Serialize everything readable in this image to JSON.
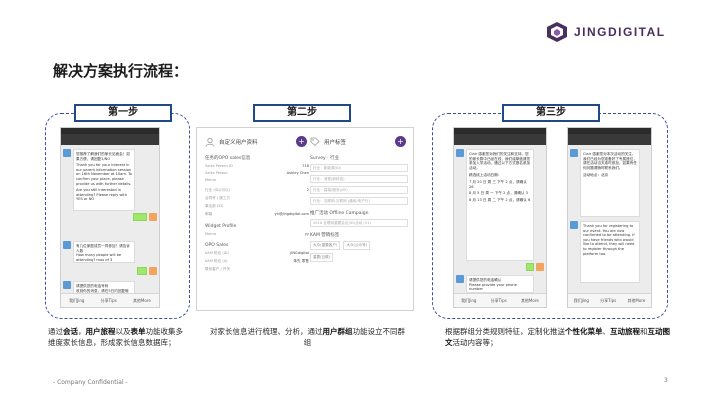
{
  "logo": {
    "text": "JINGDIGITAL"
  },
  "title": "解决方案执行流程：",
  "steps": [
    "第一步",
    "第二步",
    "第三步"
  ],
  "phone1": {
    "bottom": [
      "我们Jing",
      "分享Tips",
      "其他More"
    ],
    "msg1": "您推荐了解我们的家长见面会！如果方便，请回复1/NO",
    "msg2": "Thank you for your interest in our parent information session on 16th November at 10am. To confirm your place, please provide us with further details.",
    "msg3": "Are you still interested in attending? Please reply with YES or NO",
    "msg4": "有几位家庭成员一同参加？请告诉人数",
    "msg5": "How many people will be attending? max of 3",
    "msg6": "请提供您的电话号码",
    "msg7": "收到你的消息，请在5日内回复哦"
  },
  "panel": {
    "left_header": "自定义用户资料",
    "section1": "任务的OPO sales信息",
    "rows1": [
      {
        "k": "Sales Person ID",
        "v": "718"
      },
      {
        "k": "Sales Person",
        "v": "Ashley Chen"
      },
      {
        "k": "Memo",
        "v": ""
      }
    ],
    "rows2": [
      {
        "k": "行业 (ID)(可以)",
        "v": "2"
      },
      {
        "k": "合同号 / 施工方",
        "v": ""
      },
      {
        "k": "事业部 (ID)",
        "v": ""
      },
      {
        "k": "邮箱",
        "v": "yh@jingdigital.com"
      }
    ],
    "section2": "Widget Profile",
    "rows3": [
      {
        "k": "Memo",
        "v": "yy"
      }
    ],
    "section3": "OPO Sales",
    "rows4": [
      {
        "k": "KAM 粉丝 (ID)",
        "v": "JINGdigital"
      },
      {
        "k": "KAM 粉丝 (A)",
        "v": "朱先 零售"
      },
      {
        "k": "联系客户 / 开关",
        "v": ""
      }
    ],
    "right_header": "用户标签",
    "right_section1": "Survey · 行业",
    "right_rows": [
      "行业：新能源(ID)",
      "行业：消费(新科技)",
      "行业：高端(服务)(ID)",
      "行业：互联网-互联网 (通用/电子行)"
    ],
    "right_section2": "推广活动 Offline Campaign",
    "right_rows2": [
      "2018 互联网重要会议(ID)活动 (31)"
    ],
    "right_section3": "KAM 营销标签",
    "chips": [
      "大众(重要客户)",
      "大众(公众号)"
    ],
    "chips2": [
      "重要(互联)"
    ]
  },
  "phone2": {
    "bottom": [
      "我们Jing",
      "分享Tips",
      "其他More"
    ],
    "msg1": "Clair 感谢您对我们的关注和支持。您的家长群中已经在线，我们诚挚邀请您参加入学活动，通过以下方式报名参加活动。",
    "msg2": "精选线上活动日期：",
    "msg3": "7 月 20 日 周 三 下午 2 点，请确认 26",
    "msg4": "8 月 5 日 周 一 下午 2 点，请确认 3",
    "msg5": "8 月 13 日 周 二 下午 2 点，请确认 6",
    "msg6": "Please provide your phone number",
    "msg7": "请提供您的电话确认",
    "msg8": "Clair 感谢您参加我们的活动"
  },
  "phone3": {
    "bottom": [
      "我们Jing",
      "分享Tips",
      "其他More"
    ],
    "msg1": "Clair 感谢您对本次活动的关注，我们已经为您准备好了专属座位，请在活动当天准时参加，如果有任何问题请随时联系我们。",
    "msg2": "活动地点：北京",
    "msg3": "Thank you for registering to our event. You are now confirmed to be attending. If you have friends who would like to attend, they will need to register through the platform too."
  },
  "captions": {
    "c1": {
      "p1": "通过",
      "b1": "会话",
      "p2": "，",
      "b2": "用户旅程",
      "p3": "以及",
      "b3": "表单",
      "p4": "功能收集多维度家长信息，形成家长信息数据库；"
    },
    "c2": {
      "p1": "对家长信息进行梳理、分析，通过",
      "b1": "用户群组",
      "p2": "功能设立不同群组"
    },
    "c3": {
      "p1": "根据群组分类规则特征，定制化推送",
      "b1": "个性化菜单",
      "p2": "、",
      "b2": "互动旅程",
      "p3": "和",
      "b3": "互动图文",
      "p4": "活动内容等；"
    }
  },
  "footer": {
    "left": "- Company Confidential -",
    "page": "3"
  },
  "colors": {
    "brand": "#4a2e5e",
    "step_border": "#1f4a86",
    "dash": "#3a4fa0",
    "wechat_green": "#9fe86c"
  }
}
